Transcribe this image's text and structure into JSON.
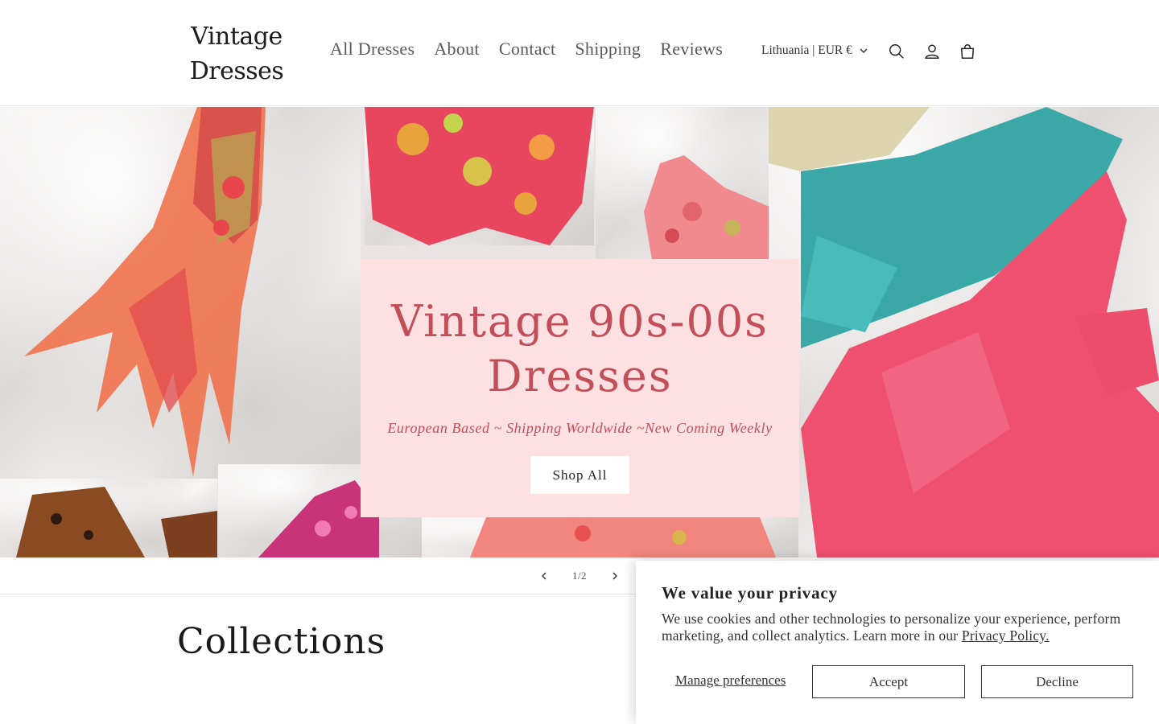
{
  "header": {
    "logo_line1": "Vintage",
    "logo_line2": "Dresses",
    "nav": [
      "All Dresses",
      "About",
      "Contact",
      "Shipping",
      "Reviews"
    ],
    "country_selector": "Lithuania | EUR €",
    "icons": [
      "search-icon",
      "account-icon",
      "cart-icon"
    ]
  },
  "hero": {
    "title": "Vintage 90s-00s Dresses",
    "subtitle": "European Based ~ Shipping Worldwide ~New Coming Weekly",
    "button": "Shop All"
  },
  "slider": {
    "counter": "1/2"
  },
  "collections": {
    "heading": "Collections"
  },
  "cookie": {
    "title": "We value your privacy",
    "text": "We use cookies and other technologies to personalize your experience, perform marketing, and collect analytics. Learn more in our",
    "link": "Privacy Policy.",
    "manage": "Manage preferences",
    "accept": "Accept",
    "decline": "Decline"
  },
  "colors": {
    "hero_box_bg": "#fde0e2",
    "hero_text": "#c24f58",
    "nav_text": "#5a5a5a"
  }
}
